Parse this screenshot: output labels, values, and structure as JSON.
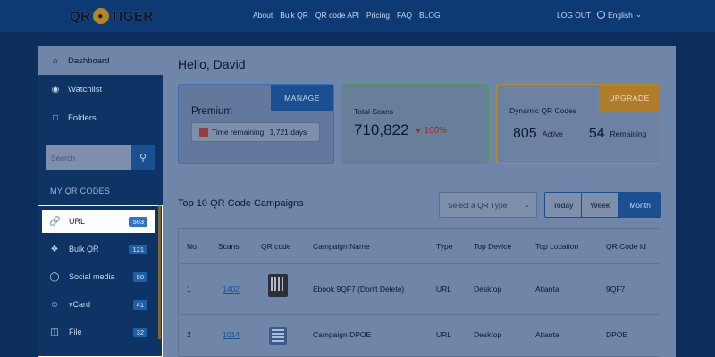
{
  "header": {
    "logo": {
      "left": "QR",
      "right": "TIGER"
    },
    "nav": [
      "About",
      "Bulk QR",
      "QR code API",
      "Pricing",
      "FAQ",
      "BLOG"
    ],
    "logout": "LOG OUT",
    "language": "English"
  },
  "sidebar": {
    "top_items": [
      {
        "label": "Dashboard",
        "icon": "home-icon"
      },
      {
        "label": "Watchlist",
        "icon": "eye-icon"
      },
      {
        "label": "Folders",
        "icon": "folder-icon"
      }
    ],
    "search_placeholder": "Search",
    "section_label": "MY QR CODES",
    "qr_types": [
      {
        "label": "URL",
        "count": "503",
        "icon": "link-icon",
        "active": true
      },
      {
        "label": "Bulk QR",
        "count": "121",
        "icon": "bulk-qr-icon"
      },
      {
        "label": "Social media",
        "count": "50",
        "icon": "chat-icon"
      },
      {
        "label": "vCard",
        "count": "41",
        "icon": "user-icon"
      },
      {
        "label": "File",
        "count": "32",
        "icon": "file-icon"
      }
    ]
  },
  "main": {
    "greeting": "Hello, David",
    "premium": {
      "title": "Premium",
      "manage": "MANAGE",
      "time_label": "Time remaining:",
      "time_value": "1,721 days"
    },
    "scans": {
      "title": "Total Scans",
      "value": "710,822",
      "delta": "100%"
    },
    "dynamic": {
      "title": "Dynamic QR Codes",
      "upgrade": "UPGRADE",
      "active_count": "805",
      "active_label": "Active",
      "remaining_count": "54",
      "remaining_label": "Remaining"
    },
    "campaigns_title": "Top 10 QR Code Campaigns",
    "select_placeholder": "Select a QR Type",
    "periods": [
      "Today",
      "Week",
      "Month"
    ],
    "table": {
      "headers": [
        "No.",
        "Scans",
        "QR code",
        "Campaign Name",
        "Type",
        "Top Device",
        "Top Location",
        "QR Code Id"
      ],
      "rows": [
        {
          "no": "1",
          "scans": "1402",
          "name": "Ebook 9QF7 (Don't Delete)",
          "type": "URL",
          "device": "Desktop",
          "location": "Atlanta",
          "id": "9QF7"
        },
        {
          "no": "2",
          "scans": "1014",
          "name": "Campaign DPOE",
          "type": "URL",
          "device": "Desktop",
          "location": "Atlanta",
          "id": "DPOE"
        }
      ]
    }
  }
}
